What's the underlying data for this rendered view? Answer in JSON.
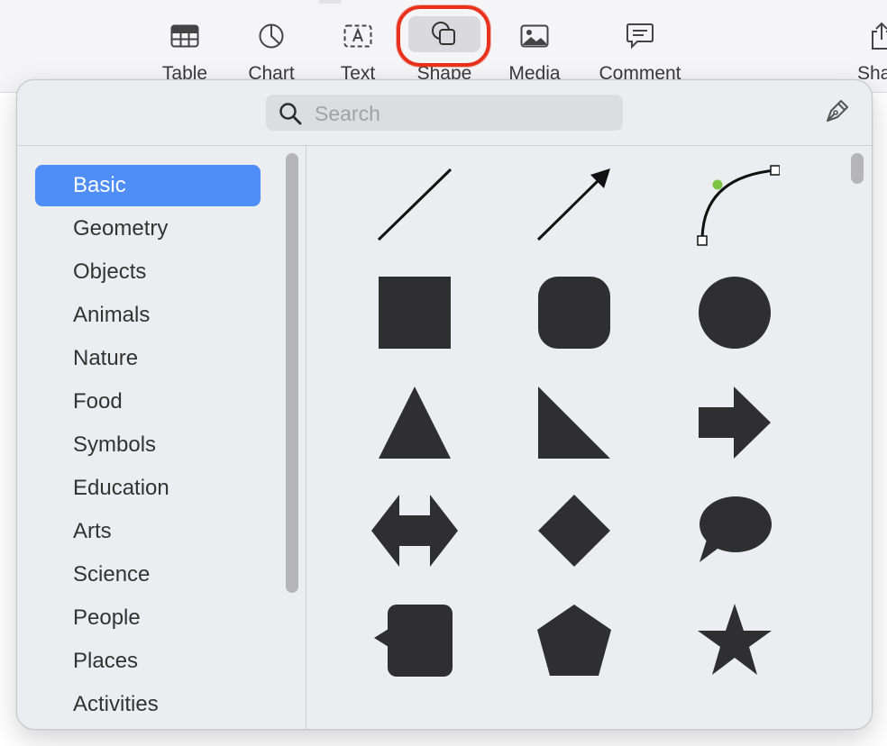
{
  "toolbar": {
    "items": [
      {
        "label": "Table",
        "icon": "table-icon"
      },
      {
        "label": "Chart",
        "icon": "chart-icon"
      },
      {
        "label": "Text",
        "icon": "text-box-icon"
      },
      {
        "label": "Shape",
        "icon": "shape-icon"
      },
      {
        "label": "Media",
        "icon": "media-icon"
      },
      {
        "label": "Comment",
        "icon": "comment-icon"
      },
      {
        "label": "Sha",
        "icon": "share-icon"
      }
    ],
    "selected": "Shape",
    "highlight_color": "#e8321d"
  },
  "popover": {
    "search": {
      "placeholder": "Search",
      "value": ""
    },
    "categories": [
      "Basic",
      "Geometry",
      "Objects",
      "Animals",
      "Nature",
      "Food",
      "Symbols",
      "Education",
      "Arts",
      "Science",
      "People",
      "Places",
      "Activities"
    ],
    "active_category": "Basic",
    "accent_color": "#4f8ef7",
    "shapes": [
      "line",
      "arrow-line",
      "curve",
      "square",
      "rounded-square",
      "circle",
      "triangle",
      "right-triangle",
      "arrow",
      "double-arrow",
      "diamond",
      "speech-bubble",
      "callout",
      "pentagon",
      "star"
    ]
  }
}
